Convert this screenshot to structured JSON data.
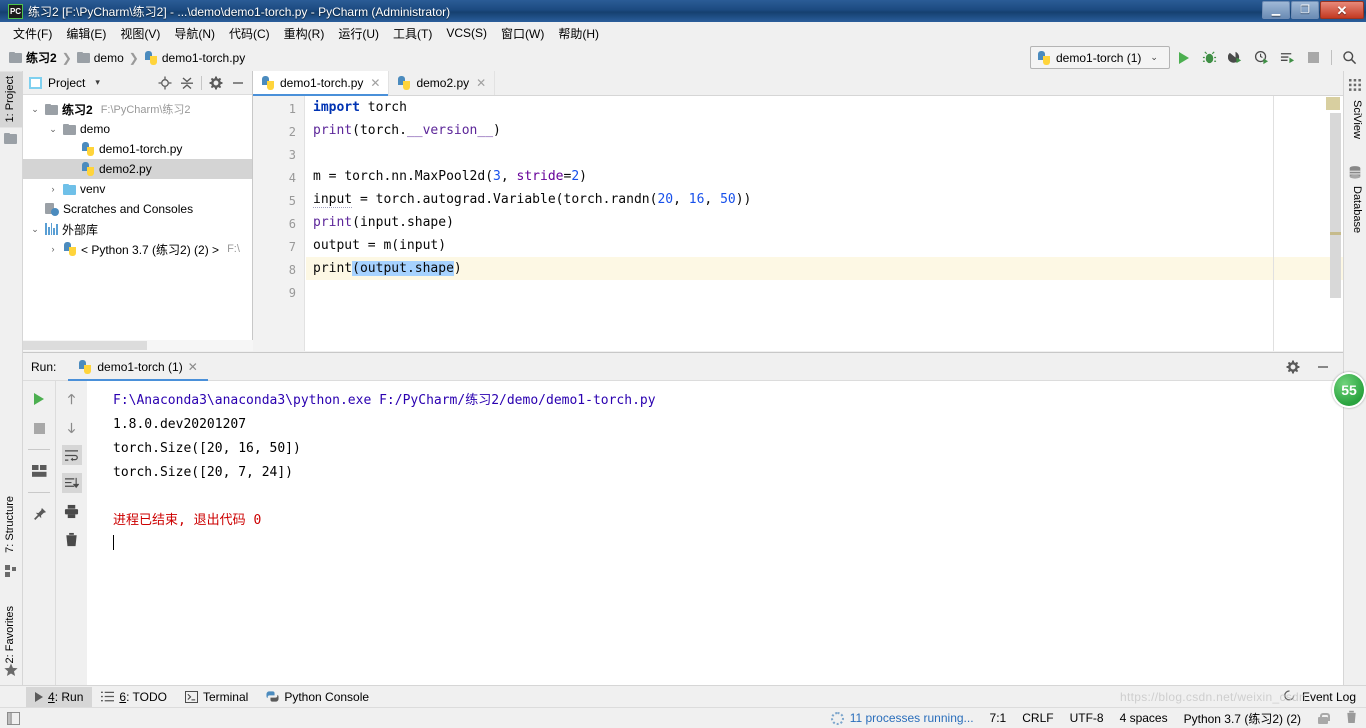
{
  "window": {
    "title": "练习2 [F:\\PyCharm\\练习2] - ...\\demo\\demo1-torch.py - PyCharm (Administrator)",
    "logo_text": "PC",
    "minimize": "—",
    "maximize": "❐",
    "close": "✕"
  },
  "menu": [
    {
      "label": "文件(F)"
    },
    {
      "label": "编辑(E)"
    },
    {
      "label": "视图(V)"
    },
    {
      "label": "导航(N)"
    },
    {
      "label": "代码(C)"
    },
    {
      "label": "重构(R)"
    },
    {
      "label": "运行(U)"
    },
    {
      "label": "工具(T)"
    },
    {
      "label": "VCS(S)"
    },
    {
      "label": "窗口(W)"
    },
    {
      "label": "帮助(H)"
    }
  ],
  "breadcrumb": {
    "items": [
      {
        "label": "练习2",
        "icon": "folder-icon",
        "bold": true
      },
      {
        "label": "demo",
        "icon": "folder-icon",
        "bold": false
      },
      {
        "label": "demo1-torch.py",
        "icon": "python-file-icon",
        "bold": false
      }
    ],
    "separator": "❯"
  },
  "toolbar": {
    "run_config": "demo1-torch (1)",
    "chevron": "⌄",
    "icons": [
      "run-icon",
      "debug-icon",
      "run-coverage-icon",
      "profile-icon",
      "run-with-console-icon",
      "stop-icon",
      "search-everywhere-icon"
    ]
  },
  "left_strip": {
    "project_tab": "1: Project",
    "structure_tab": "7: Structure",
    "favorites_tab": "2: Favorites"
  },
  "right_strip": {
    "sciview_tab": "SciView",
    "database_tab": "Database"
  },
  "project_panel": {
    "title": "Project",
    "title_chevron": "▾",
    "header_icons": [
      "locate-icon",
      "collapse-all-icon",
      "settings-gear-icon",
      "hide-icon"
    ],
    "tree": [
      {
        "indent": 0,
        "twisty": "⌄",
        "icon": "folder-icon",
        "label": "练习2",
        "bold": true,
        "path": "F:\\PyCharm\\练习2",
        "selected": false
      },
      {
        "indent": 1,
        "twisty": "⌄",
        "icon": "folder-icon",
        "label": "demo",
        "bold": false,
        "path": "",
        "selected": false
      },
      {
        "indent": 2,
        "twisty": "",
        "icon": "python-file-icon",
        "label": "demo1-torch.py",
        "bold": false,
        "path": "",
        "selected": false
      },
      {
        "indent": 2,
        "twisty": "",
        "icon": "python-file-icon",
        "label": "demo2.py",
        "bold": false,
        "path": "",
        "selected": true
      },
      {
        "indent": 1,
        "twisty": "›",
        "icon": "folder-blue-icon",
        "label": "venv",
        "bold": false,
        "path": "",
        "selected": false
      },
      {
        "indent": 0,
        "twisty": "",
        "icon": "scratches-icon",
        "label": "Scratches and Consoles",
        "bold": false,
        "path": "",
        "selected": false
      },
      {
        "indent": 0,
        "twisty": "⌄",
        "icon": "library-icon",
        "label": "外部库",
        "bold": false,
        "path": "",
        "selected": false
      },
      {
        "indent": 1,
        "twisty": "›",
        "icon": "python-sdk-icon",
        "label": "< Python 3.7 (练习2) (2) >",
        "bold": false,
        "path": "F:\\",
        "selected": false
      }
    ]
  },
  "editor": {
    "tabs": [
      {
        "label": "demo1-torch.py",
        "icon": "python-file-icon",
        "active": true,
        "close": "✕"
      },
      {
        "label": "demo2.py",
        "icon": "python-file-icon",
        "active": false,
        "close": "✕"
      }
    ],
    "line_numbers": [
      "1",
      "2",
      "3",
      "4",
      "5",
      "6",
      "7",
      "8",
      "9"
    ],
    "code_lines": [
      "import torch",
      "print(torch.__version__)",
      "",
      "m = torch.nn.MaxPool2d(3, stride=2)",
      "input = torch.autograd.Variable(torch.randn(20, 16, 50))",
      "print(input.shape)",
      "output = m(input)",
      "print(output.shape)",
      ""
    ],
    "highlighted_line": 8,
    "selection_text": "(output.shape"
  },
  "run_panel": {
    "label": "Run:",
    "tab_label": "demo1-torch (1)",
    "tab_close": "✕",
    "settings_icon": "gear-icon",
    "hide_icon": "hide-icon",
    "toolbar_left": [
      "rerun-icon",
      "stop-icon",
      "restore-layout-icon",
      "pin-tab-icon"
    ],
    "toolbar_right": [
      "up-arrow-icon",
      "down-arrow-icon",
      "soft-wrap-icon",
      "scroll-to-end-icon",
      "print-icon",
      "clear-all-icon"
    ],
    "console_lines": [
      {
        "text": "F:\\Anaconda3\\anaconda3\\python.exe F:/PyCharm/练习2/demo/demo1-torch.py",
        "style": "cmd"
      },
      {
        "text": "1.8.0.dev20201207",
        "style": "plain"
      },
      {
        "text": "torch.Size([20, 16, 50])",
        "style": "plain"
      },
      {
        "text": "torch.Size([20, 7, 24])",
        "style": "plain"
      },
      {
        "text": "",
        "style": "plain"
      },
      {
        "text": "进程已结束, 退出代码 0",
        "style": "red"
      }
    ],
    "badge": "55"
  },
  "bottom_bar": {
    "buttons": [
      {
        "label": "4: Run",
        "icon": "run-icon",
        "underline_char": "4",
        "active": true
      },
      {
        "label": "6: TODO",
        "icon": "todo-icon",
        "underline_char": "6",
        "active": false
      },
      {
        "label": "Terminal",
        "icon": "terminal-icon",
        "underline_char": "",
        "active": false
      },
      {
        "label": "Python Console",
        "icon": "python-console-icon",
        "underline_char": "",
        "active": false
      }
    ],
    "event_log": "Event Log",
    "event_log_icon": "event-log-icon"
  },
  "status_bar": {
    "left_icon": "show-tool-windows-icon",
    "processes": "11 processes running...",
    "caret_position": "7:1",
    "line_separator": "CRLF",
    "encoding": "UTF-8",
    "indent": "4 spaces",
    "interpreter": "Python 3.7 (练习2) (2)",
    "lock_icon": "lock-icon",
    "trash_icon": "memory-indicator-icon",
    "watermark": "https://blog.csdn.net/weixin_csdn"
  },
  "colors": {
    "accent_blue": "#4a90d9",
    "title_blue": "#1c4a80",
    "keyword": "#0033b3",
    "function": "#5c2699",
    "number": "#1750eb",
    "error_red": "#cc0000",
    "console_cmd": "#2a00b0",
    "selection": "#a6d2ff",
    "highlight_line": "#fdf8e4",
    "panel_bg": "#f0f0f0"
  }
}
